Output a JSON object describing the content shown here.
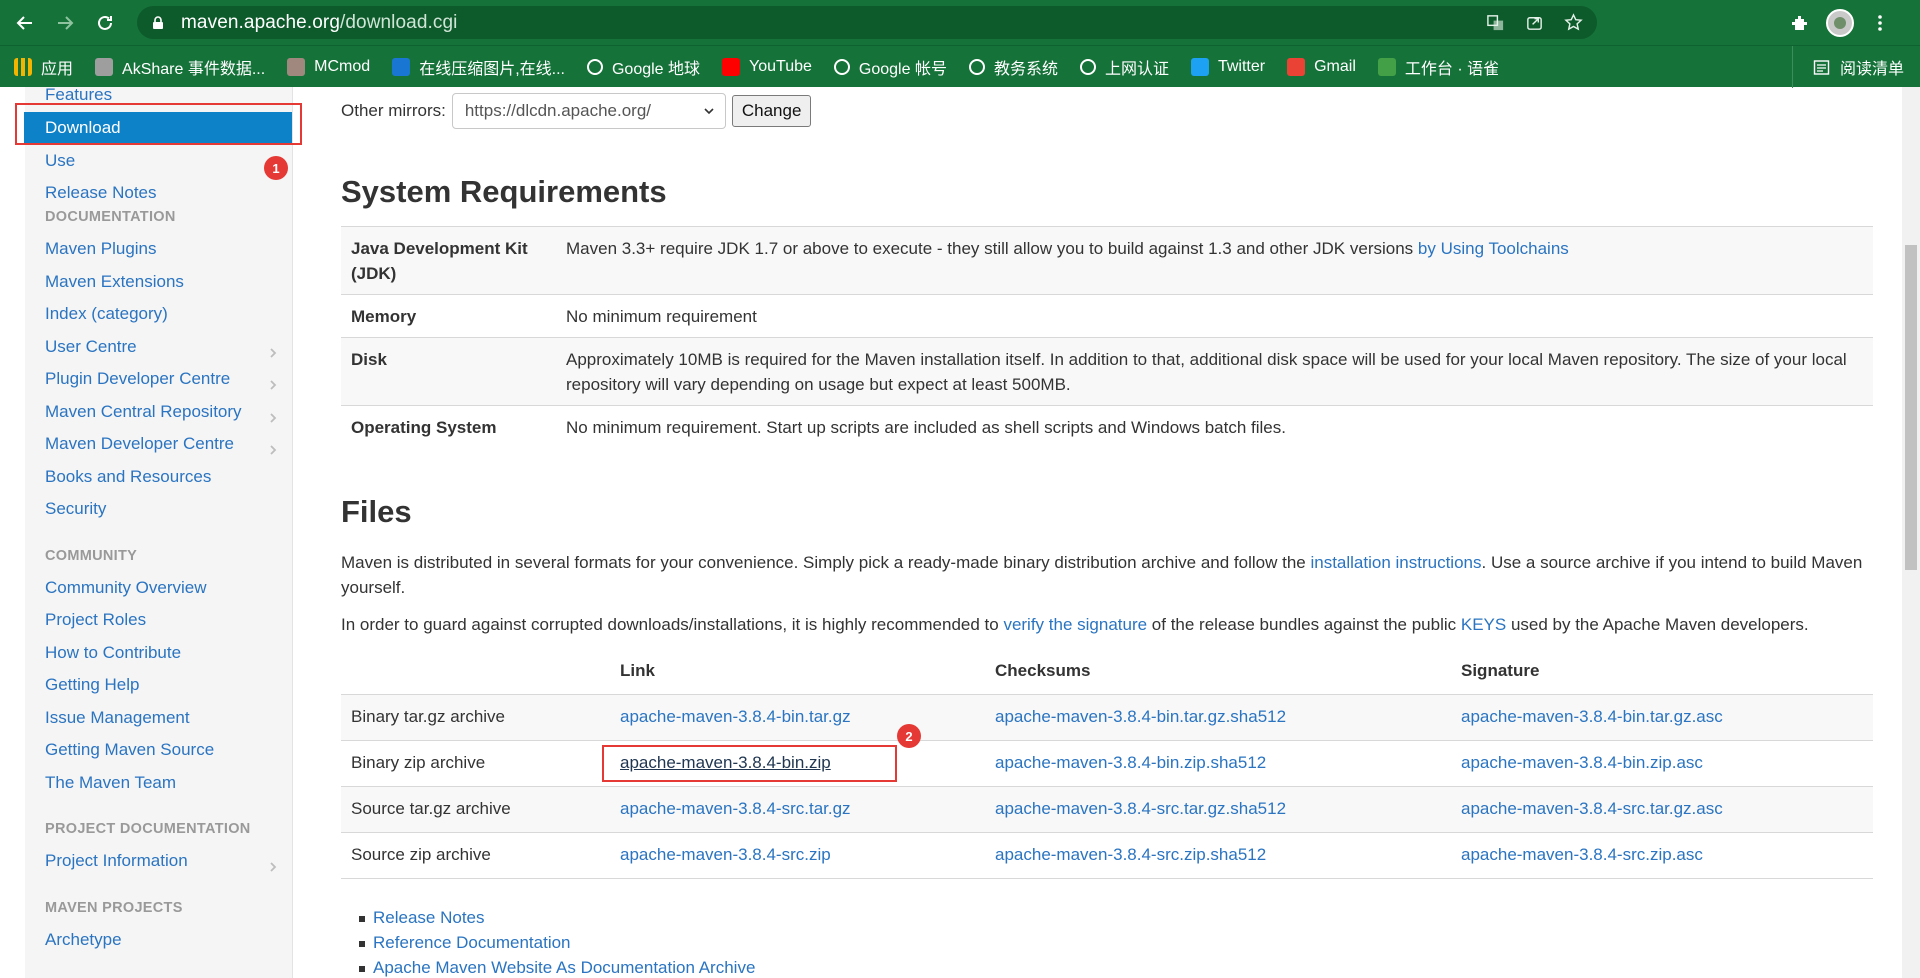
{
  "browser": {
    "url_host": "maven.apache.org",
    "url_path": "/download.cgi",
    "bookmarks": [
      {
        "label": "应用",
        "icon": "apps-grid-icon",
        "color": "#f4b400"
      },
      {
        "label": "AkShare 事件数据...",
        "icon": "bookmark-page-icon",
        "color": "#9e9e9e"
      },
      {
        "label": "MCmod",
        "icon": "mcmod-icon",
        "color": "#a1887f"
      },
      {
        "label": "在线压缩图片,在线...",
        "icon": "tinypng-icon",
        "color": "#1976d2"
      },
      {
        "label": "Google 地球",
        "icon": "globe-icon",
        "color": "#ffffff"
      },
      {
        "label": "YouTube",
        "icon": "youtube-icon",
        "color": "#ff0000"
      },
      {
        "label": "Google 帐号",
        "icon": "google-icon",
        "color": "#ffffff"
      },
      {
        "label": "教务系统",
        "icon": "globe-icon",
        "color": "#ffffff"
      },
      {
        "label": "上网认证",
        "icon": "globe-icon",
        "color": "#ffffff"
      },
      {
        "label": "Twitter",
        "icon": "twitter-icon",
        "color": "#1da1f2"
      },
      {
        "label": "Gmail",
        "icon": "gmail-icon",
        "color": "#ea4335"
      },
      {
        "label": "工作台 · 语雀",
        "icon": "yuque-icon",
        "color": "#43a047"
      }
    ],
    "reading_list": "阅读清单"
  },
  "sidebar": {
    "top_items": [
      "Features"
    ],
    "active_item": "Download",
    "items_after_active": [
      "Use",
      "Release Notes"
    ],
    "sections": [
      {
        "header": "DOCUMENTATION",
        "items": [
          {
            "label": "Maven Plugins",
            "chevron": false
          },
          {
            "label": "Maven Extensions",
            "chevron": false
          },
          {
            "label": "Index (category)",
            "chevron": false
          },
          {
            "label": "User Centre",
            "chevron": true
          },
          {
            "label": "Plugin Developer Centre",
            "chevron": true
          },
          {
            "label": "Maven Central Repository",
            "chevron": true
          },
          {
            "label": "Maven Developer Centre",
            "chevron": true
          },
          {
            "label": "Books and Resources",
            "chevron": false
          },
          {
            "label": "Security",
            "chevron": false
          }
        ]
      },
      {
        "header": "COMMUNITY",
        "items": [
          {
            "label": "Community Overview",
            "chevron": false
          },
          {
            "label": "Project Roles",
            "chevron": false
          },
          {
            "label": "How to Contribute",
            "chevron": false
          },
          {
            "label": "Getting Help",
            "chevron": false
          },
          {
            "label": "Issue Management",
            "chevron": false
          },
          {
            "label": "Getting Maven Source",
            "chevron": false
          },
          {
            "label": "The Maven Team",
            "chevron": false
          }
        ]
      },
      {
        "header": "PROJECT DOCUMENTATION",
        "items": [
          {
            "label": "Project Information",
            "chevron": true
          }
        ]
      },
      {
        "header": "MAVEN PROJECTS",
        "items": [
          {
            "label": "Archetype",
            "chevron": false
          }
        ]
      }
    ]
  },
  "annotations": {
    "badge1": "1",
    "badge2": "2"
  },
  "mirror": {
    "label": "Other mirrors:",
    "selected": "https://dlcdn.apache.org/",
    "change_label": "Change"
  },
  "requirements": {
    "heading": "System Requirements",
    "rows": [
      {
        "key": "Java Development Kit (JDK)",
        "value": "Maven 3.3+ require JDK 1.7 or above to execute - they still allow you to build against 1.3 and other JDK versions ",
        "link": "by Using Toolchains"
      },
      {
        "key": "Memory",
        "value": "No minimum requirement",
        "link": ""
      },
      {
        "key": "Disk",
        "value": "Approximately 10MB is required for the Maven installation itself. In addition to that, additional disk space will be used for your local Maven repository. The size of your local repository will vary depending on usage but expect at least 500MB.",
        "link": ""
      },
      {
        "key": "Operating System",
        "value": "No minimum requirement. Start up scripts are included as shell scripts and Windows batch files.",
        "link": ""
      }
    ]
  },
  "files": {
    "heading": "Files",
    "intro_before": "Maven is distributed in several formats for your convenience. Simply pick a ready-made binary distribution archive and follow the ",
    "intro_link": "installation instructions",
    "intro_after": ". Use a source archive if you intend to build Maven yourself.",
    "guard_before": "In order to guard against corrupted downloads/installations, it is highly recommended to ",
    "guard_link1": "verify the signature",
    "guard_mid": " of the release bundles against the public ",
    "guard_link2": "KEYS",
    "guard_after": " used by the Apache Maven developers.",
    "columns": [
      "",
      "Link",
      "Checksums",
      "Signature"
    ],
    "rows": [
      {
        "type": "Binary tar.gz archive",
        "link": "apache-maven-3.8.4-bin.tar.gz",
        "checksum": "apache-maven-3.8.4-bin.tar.gz.sha512",
        "signature": "apache-maven-3.8.4-bin.tar.gz.asc"
      },
      {
        "type": "Binary zip archive",
        "link": "apache-maven-3.8.4-bin.zip",
        "checksum": "apache-maven-3.8.4-bin.zip.sha512",
        "signature": "apache-maven-3.8.4-bin.zip.asc"
      },
      {
        "type": "Source tar.gz archive",
        "link": "apache-maven-3.8.4-src.tar.gz",
        "checksum": "apache-maven-3.8.4-src.tar.gz.sha512",
        "signature": "apache-maven-3.8.4-src.tar.gz.asc"
      },
      {
        "type": "Source zip archive",
        "link": "apache-maven-3.8.4-src.zip",
        "checksum": "apache-maven-3.8.4-src.zip.sha512",
        "signature": "apache-maven-3.8.4-src.zip.asc"
      }
    ],
    "bullets": [
      "Release Notes",
      "Reference Documentation",
      "Apache Maven Website As Documentation Archive"
    ]
  },
  "colors": {
    "accent": "#157239",
    "link": "#2a74c1",
    "active": "#0e82c9",
    "annotation": "#e53935"
  }
}
